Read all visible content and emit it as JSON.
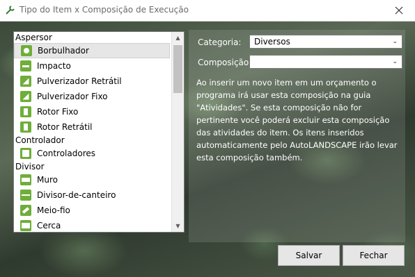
{
  "window": {
    "title": "Tipo do Item x Composição de Execução",
    "close_glyph": "✕"
  },
  "list": {
    "groups": [
      {
        "label": "Aspersor",
        "items": [
          {
            "label": "Borbulhador",
            "icon": "bubbler-icon",
            "selected": true
          },
          {
            "label": "Impacto",
            "icon": "impact-sprinkler-icon"
          },
          {
            "label": "Pulverizador Retrátil",
            "icon": "retractable-spray-icon"
          },
          {
            "label": "Pulverizador Fixo",
            "icon": "fixed-spray-icon"
          },
          {
            "label": "Rotor Fixo",
            "icon": "fixed-rotor-icon"
          },
          {
            "label": "Rotor Retrátil",
            "icon": "retractable-rotor-icon"
          }
        ]
      },
      {
        "label": "Controlador",
        "items": [
          {
            "label": "Controladores",
            "icon": "controller-icon"
          }
        ]
      },
      {
        "label": "Divisor",
        "items": [
          {
            "label": "Muro",
            "icon": "wall-icon"
          },
          {
            "label": "Divisor-de-canteiro",
            "icon": "bed-divider-icon"
          },
          {
            "label": "Meio-fio",
            "icon": "curb-icon"
          },
          {
            "label": "Cerca",
            "icon": "fence-icon"
          }
        ]
      }
    ]
  },
  "form": {
    "categoria_label": "Categoria:",
    "categoria_value": "Diversos",
    "composicao_label": "Composição:",
    "composicao_value": "",
    "info_text": "Ao inserir um novo item em um orçamento o programa irá usar esta composição na guia \"Atividades\". Se esta composição não for pertinente você poderá excluir esta composição das atividades do item. Os itens inseridos automaticamente pelo AutoLANDSCAPE irão levar esta composição também."
  },
  "buttons": {
    "save_label": "Salvar",
    "close_label": "Fechar"
  },
  "colors": {
    "icon_green": "#6fae3a",
    "selection": "#e6e6e6"
  }
}
